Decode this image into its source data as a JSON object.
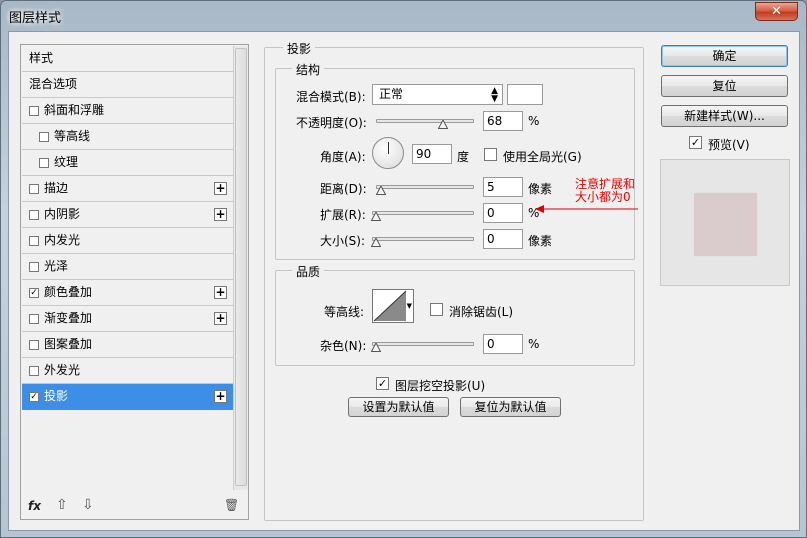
{
  "window": {
    "title": "图层样式",
    "close_glyph": "✕"
  },
  "sidebar": {
    "items": [
      {
        "label": "样式",
        "has_checkbox": false,
        "checked": false,
        "has_plus": false,
        "indent": 0
      },
      {
        "label": "混合选项",
        "has_checkbox": false,
        "checked": false,
        "has_plus": false,
        "indent": 0
      },
      {
        "label": "斜面和浮雕",
        "has_checkbox": true,
        "checked": false,
        "has_plus": false,
        "indent": 0
      },
      {
        "label": "等高线",
        "has_checkbox": true,
        "checked": false,
        "has_plus": false,
        "indent": 1
      },
      {
        "label": "纹理",
        "has_checkbox": true,
        "checked": false,
        "has_plus": false,
        "indent": 1
      },
      {
        "label": "描边",
        "has_checkbox": true,
        "checked": false,
        "has_plus": true,
        "indent": 0
      },
      {
        "label": "内阴影",
        "has_checkbox": true,
        "checked": false,
        "has_plus": true,
        "indent": 0
      },
      {
        "label": "内发光",
        "has_checkbox": true,
        "checked": false,
        "has_plus": false,
        "indent": 0
      },
      {
        "label": "光泽",
        "has_checkbox": true,
        "checked": false,
        "has_plus": false,
        "indent": 0
      },
      {
        "label": "颜色叠加",
        "has_checkbox": true,
        "checked": true,
        "has_plus": true,
        "indent": 0
      },
      {
        "label": "渐变叠加",
        "has_checkbox": true,
        "checked": false,
        "has_plus": true,
        "indent": 0
      },
      {
        "label": "图案叠加",
        "has_checkbox": true,
        "checked": false,
        "has_plus": false,
        "indent": 0
      },
      {
        "label": "外发光",
        "has_checkbox": true,
        "checked": false,
        "has_plus": false,
        "indent": 0
      },
      {
        "label": "投影",
        "has_checkbox": true,
        "checked": true,
        "has_plus": true,
        "indent": 0,
        "selected": true
      }
    ],
    "bottom": {
      "fx_label": "fx",
      "up_glyph": "⇧",
      "down_glyph": "⇩",
      "trash_glyph": "🗑"
    }
  },
  "drop_shadow": {
    "section_title": "投影",
    "structure": {
      "title": "结构",
      "blend_mode_label": "混合模式(B):",
      "blend_mode_value": "正常",
      "opacity_label": "不透明度(O):",
      "opacity_value": "68",
      "opacity_unit": "%",
      "opacity_fraction": 0.68,
      "angle_label": "角度(A):",
      "angle_value": "90",
      "angle_unit": "度",
      "global_light_label": "使用全局光(G)",
      "global_light_checked": false,
      "distance_label": "距离(D):",
      "distance_value": "5",
      "distance_unit": "像素",
      "spread_label": "扩展(R):",
      "spread_value": "0",
      "spread_unit": "%",
      "size_label": "大小(S):",
      "size_value": "0",
      "size_unit": "像素"
    },
    "quality": {
      "title": "品质",
      "contour_label": "等高线:",
      "anti_alias_label": "消除锯齿(L)",
      "anti_alias_checked": false,
      "noise_label": "杂色(N):",
      "noise_value": "0",
      "noise_unit": "%"
    },
    "knockout_label": "图层挖空投影(U)",
    "knockout_checked": true,
    "make_default_label": "设置为默认值",
    "reset_default_label": "复位为默认值"
  },
  "annotation": {
    "line1": "注意扩展和",
    "line2": "大小都为0",
    "color": "#e00000"
  },
  "actions": {
    "ok_label": "确定",
    "reset_label": "复位",
    "new_style_label": "新建样式(W)...",
    "preview_label": "预览(V)",
    "preview_checked": true
  },
  "colors": {
    "selection": "#3d8ee6",
    "preview_swatch": "#dacccc"
  }
}
